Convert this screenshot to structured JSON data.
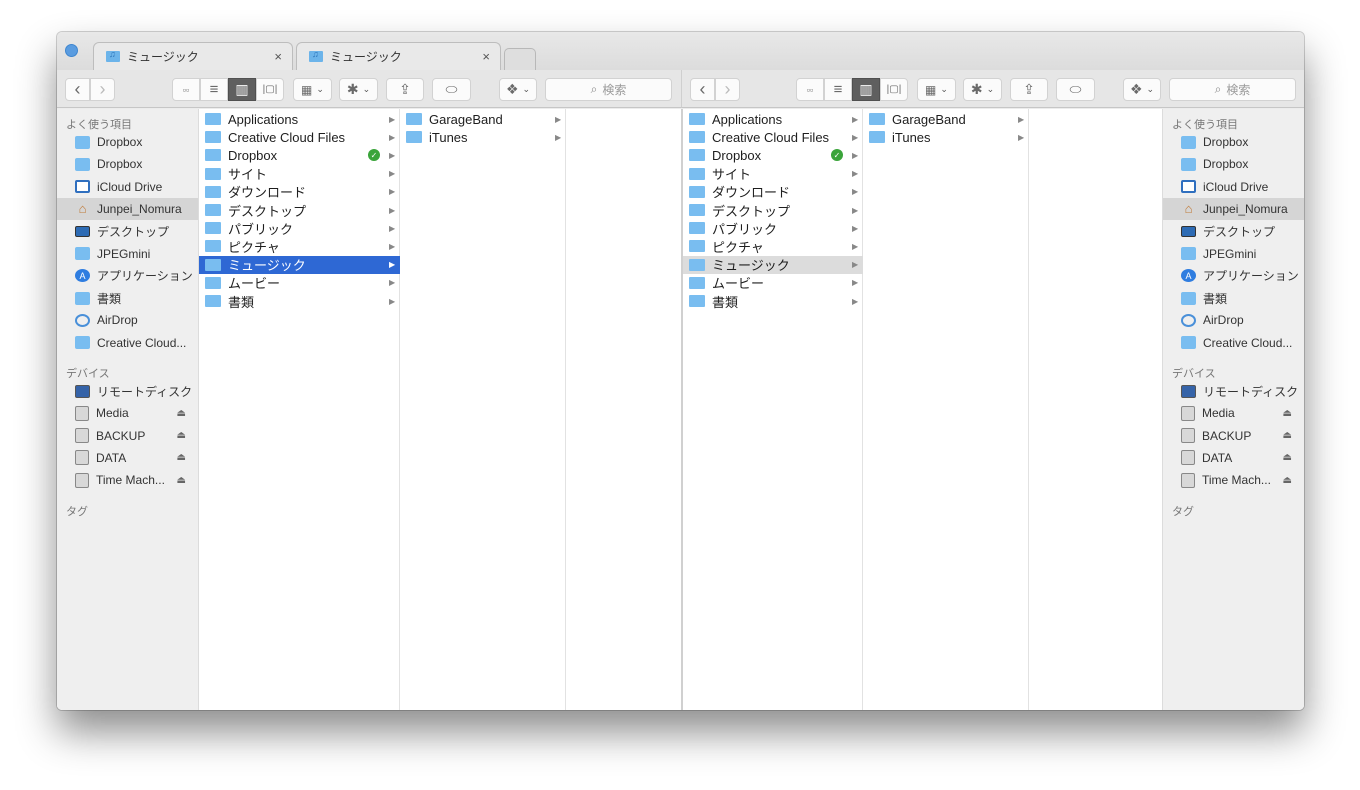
{
  "window": {
    "tabs": [
      {
        "label": "ミュージック",
        "icon": "music-folder-icon",
        "close": "×"
      },
      {
        "label": "ミュージック",
        "icon": "music-folder-icon",
        "close": "×"
      }
    ]
  },
  "toolbar": {
    "back": "‹",
    "forward": "›",
    "view_icons": "▫▫",
    "view_list": "≡",
    "view_columns": "▥",
    "view_coverflow": "|▢|",
    "arrange": "▦",
    "action": "✱",
    "share": "⇪",
    "tag": "⬭",
    "dropbox": "❖",
    "chevron": "⌄",
    "search_placeholder": "検索",
    "search_icon": "⌕"
  },
  "sidebar": {
    "favorites_header": "よく使う項目",
    "favorites": [
      {
        "label": "Dropbox",
        "icon": "dropbox-folder-icon"
      },
      {
        "label": "Dropbox",
        "icon": "dropbox-folder-icon"
      },
      {
        "label": "iCloud Drive",
        "icon": "icloud-drive-icon"
      },
      {
        "label": "Junpei_Nomura",
        "icon": "home-icon",
        "selected": true
      },
      {
        "label": "デスクトップ",
        "icon": "desktop-icon"
      },
      {
        "label": "JPEGmini",
        "icon": "folder-icon"
      },
      {
        "label": "アプリケーション",
        "icon": "applications-icon"
      },
      {
        "label": "書類",
        "icon": "documents-folder-icon"
      },
      {
        "label": "AirDrop",
        "icon": "airdrop-icon"
      },
      {
        "label": "Creative Cloud...",
        "icon": "creative-cloud-folder-icon"
      }
    ],
    "devices_header": "デバイス",
    "devices": [
      {
        "label": "リモートディスク",
        "icon": "remote-disc-icon",
        "eject": false
      },
      {
        "label": "Media",
        "icon": "hard-disk-icon",
        "eject": true
      },
      {
        "label": "BACKUP",
        "icon": "hard-disk-icon",
        "eject": true
      },
      {
        "label": "DATA",
        "icon": "hard-disk-icon",
        "eject": true
      },
      {
        "label": "Time Mach...",
        "icon": "hard-disk-icon",
        "eject": true
      }
    ],
    "tags_header": "タグ",
    "eject_glyph": "⏏"
  },
  "home_column": [
    {
      "label": "Applications"
    },
    {
      "label": "Creative Cloud Files"
    },
    {
      "label": "Dropbox",
      "synced": true
    },
    {
      "label": "サイト"
    },
    {
      "label": "ダウンロード"
    },
    {
      "label": "デスクトップ"
    },
    {
      "label": "パブリック"
    },
    {
      "label": "ピクチャ"
    },
    {
      "label": "ミュージック",
      "selected": true
    },
    {
      "label": "ムービー"
    },
    {
      "label": "書類"
    }
  ],
  "music_column": [
    {
      "label": "GarageBand"
    },
    {
      "label": "iTunes"
    }
  ],
  "glyphs": {
    "arrow": "▶",
    "check": "✓"
  },
  "colors": {
    "selection": "#2e68d4",
    "inactive_selection": "#dcdcdc",
    "folder": "#79bdf0",
    "sync_ok": "#3aa43a"
  }
}
